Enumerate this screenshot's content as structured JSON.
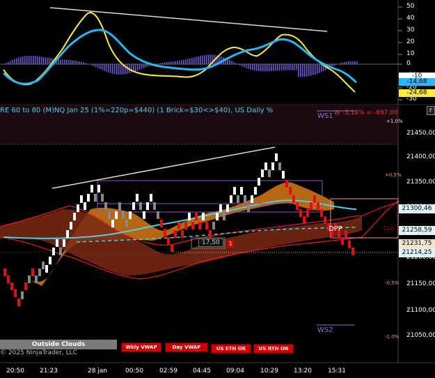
{
  "chart_title": "RE 60 to 80 (M)NQ Jan 25 (1%=220p=$440) (1 Brick=$30<>$40), US Daily %",
  "ws_stat": "W -3,18% = -697,00",
  "ws1": "WS1",
  "ws2": "WS2",
  "oscillator": {
    "y_ticks": [
      "50",
      "40",
      "30",
      "20",
      "10",
      "0",
      "-10",
      "-20",
      "-30"
    ],
    "tags": [
      {
        "text": "-10",
        "color": "#4fc3f7",
        "bg": "#ffffff",
        "fg": "#000000"
      },
      {
        "text": "-14,68",
        "color": "#4fc3f7",
        "bg": "#29b6f6",
        "fg": "#000000"
      },
      {
        "text": "-24,68",
        "color": "#ffeb3b",
        "bg": "#ffeb3b",
        "fg": "#000000"
      }
    ]
  },
  "price_axis": {
    "ticks": [
      "21450,00",
      "21400,00",
      "21350,00",
      "21300,00",
      "21250,00",
      "21200,00",
      "21150,00",
      "21100,00",
      "21050,00"
    ],
    "tags": [
      {
        "text": "21300,46",
        "bg": "#e0f7fa",
        "fg": "#000000"
      },
      {
        "text": "21258,59",
        "bg": "#e0f7fa",
        "fg": "#000000"
      },
      {
        "text": "21231,75",
        "bg": "#f4e4cc",
        "fg": "#000000"
      },
      {
        "text": "21214,25",
        "bg": "#e0f7fa",
        "fg": "#000000"
      }
    ]
  },
  "pct_labels": [
    "+1.0%",
    "+0.5%",
    "-0.5%",
    "-1.0%"
  ],
  "box_value": "17,50",
  "box_count": "1",
  "dpp": "DPP",
  "clo": "CLO",
  "buttons": {
    "outside_clouds": "Outside Clouds",
    "wkly_vwap": "Wkly VWAP",
    "day_vwap": "Day VWAP",
    "us_eth_or": "US ETH OR",
    "us_rth_or": "US RTH OR"
  },
  "copyright": "© 2025 NinjaTrader, LLC",
  "x_labels": [
    "20:50",
    "21:23",
    "28 jan",
    "00:50",
    "02:59",
    "04:45",
    "09:04",
    "10:29",
    "13:20",
    "15:31"
  ],
  "window_icon": "F"
}
